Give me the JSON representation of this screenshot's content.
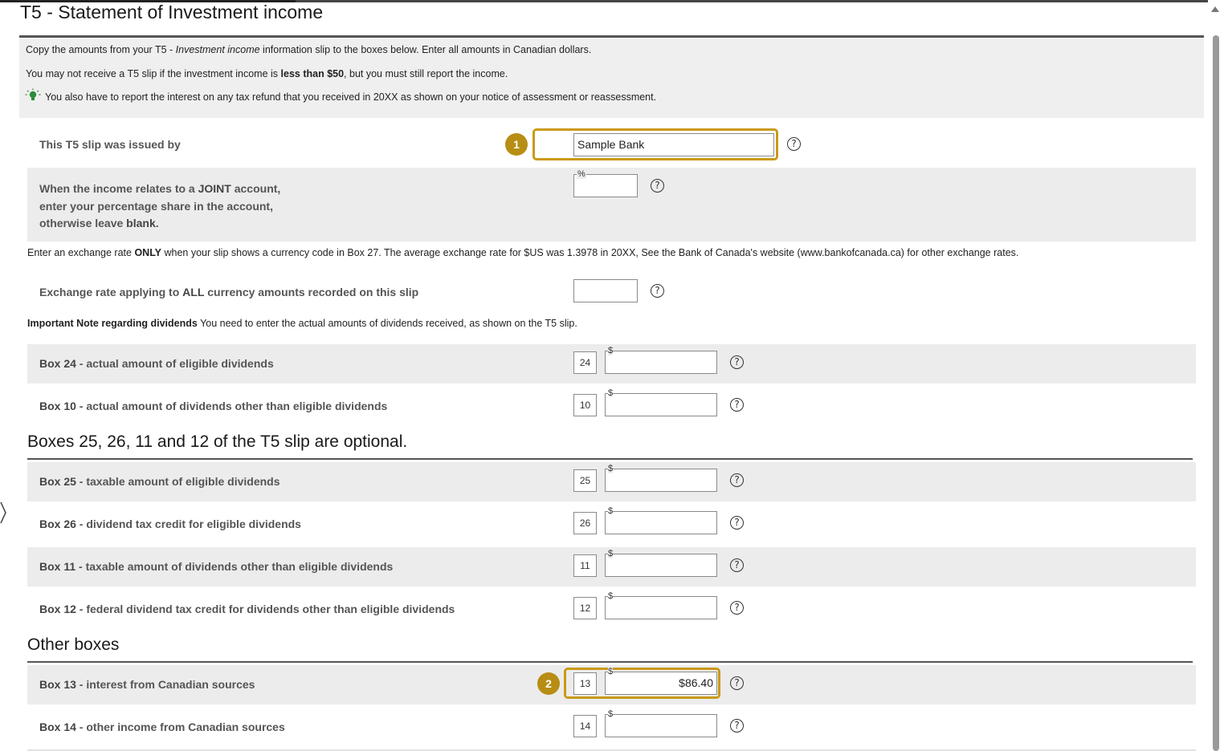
{
  "title": "T5 - Statement of Investment income",
  "info": {
    "line1_pre": "Copy the amounts from your T5 - ",
    "line1_italic": "Investment income",
    "line1_post": " information slip to the boxes below. Enter all amounts in Canadian dollars.",
    "line2_pre": "You may not receive a T5 slip if the investment income is ",
    "line2_bold": "less than $50",
    "line2_post": ", but you must still report the income.",
    "line3": "You also have to report the interest on any tax refund that you received in 20XX as shown on your notice of assessment or reassessment.",
    "tip_icon": "lightbulb-icon"
  },
  "issuer": {
    "label": "This T5 slip was issued by",
    "value": "Sample Bank",
    "badge": "1"
  },
  "joint": {
    "label_l1_pre": "When the income relates to a ",
    "label_l1_bold": "JOINT",
    "label_l1_post": " account,",
    "label_l2": "enter your percentage share in the account,",
    "label_l3_pre": "otherwise leave ",
    "label_l3_bold": "blank",
    "label_l3_post": ".",
    "unit": "%"
  },
  "exchange_note": {
    "pre": "Enter an exchange rate ",
    "bold": "ONLY",
    "post": " when your slip shows a currency code in Box 27. The average exchange rate for $US was 1.3978 in 20XX, See the Bank of Canada's website (www.bankofcanada.ca) for other exchange rates."
  },
  "exchange_rate": {
    "label_pre": "Exchange rate applying to ",
    "label_bold": "ALL",
    "label_post": " currency amounts recorded on this slip"
  },
  "dividend_note": {
    "bold": "Important Note regarding dividends",
    "text": " You need to enter the actual amounts of dividends received, as shown on the T5 slip."
  },
  "currency_tag": "$",
  "help_glyph": "?",
  "boxes_main": [
    {
      "box": "Box 24",
      "desc": " - actual amount of eligible dividends",
      "num": "24",
      "value": ""
    },
    {
      "box": "Box 10",
      "desc": " - actual amount of dividends other than eligible dividends",
      "num": "10",
      "value": ""
    }
  ],
  "optional_section": {
    "title": "Boxes 25, 26, 11 and 12 of the T5 slip are optional.",
    "rows": [
      {
        "box": "Box 25",
        "desc": " - taxable amount of eligible dividends",
        "num": "25",
        "value": ""
      },
      {
        "box": "Box 26",
        "desc": " - dividend tax credit for eligible dividends",
        "num": "26",
        "value": ""
      },
      {
        "box": "Box 11",
        "desc": " - taxable amount of dividends other than eligible dividends",
        "num": "11",
        "value": ""
      },
      {
        "box": "Box 12",
        "desc": " - federal dividend tax credit for dividends other than eligible dividends",
        "num": "12",
        "value": ""
      }
    ]
  },
  "other_section": {
    "title": "Other boxes",
    "rows": [
      {
        "box": "Box 13",
        "desc": " - interest from Canadian sources",
        "num": "13",
        "value": "$86.40",
        "badge": "2"
      },
      {
        "box": "Box 14",
        "desc": " - other income from Canadian sources",
        "num": "14",
        "value": ""
      }
    ]
  },
  "colors": {
    "highlight": "#c99a16",
    "badge": "#b88d14",
    "shade": "#ececec"
  }
}
